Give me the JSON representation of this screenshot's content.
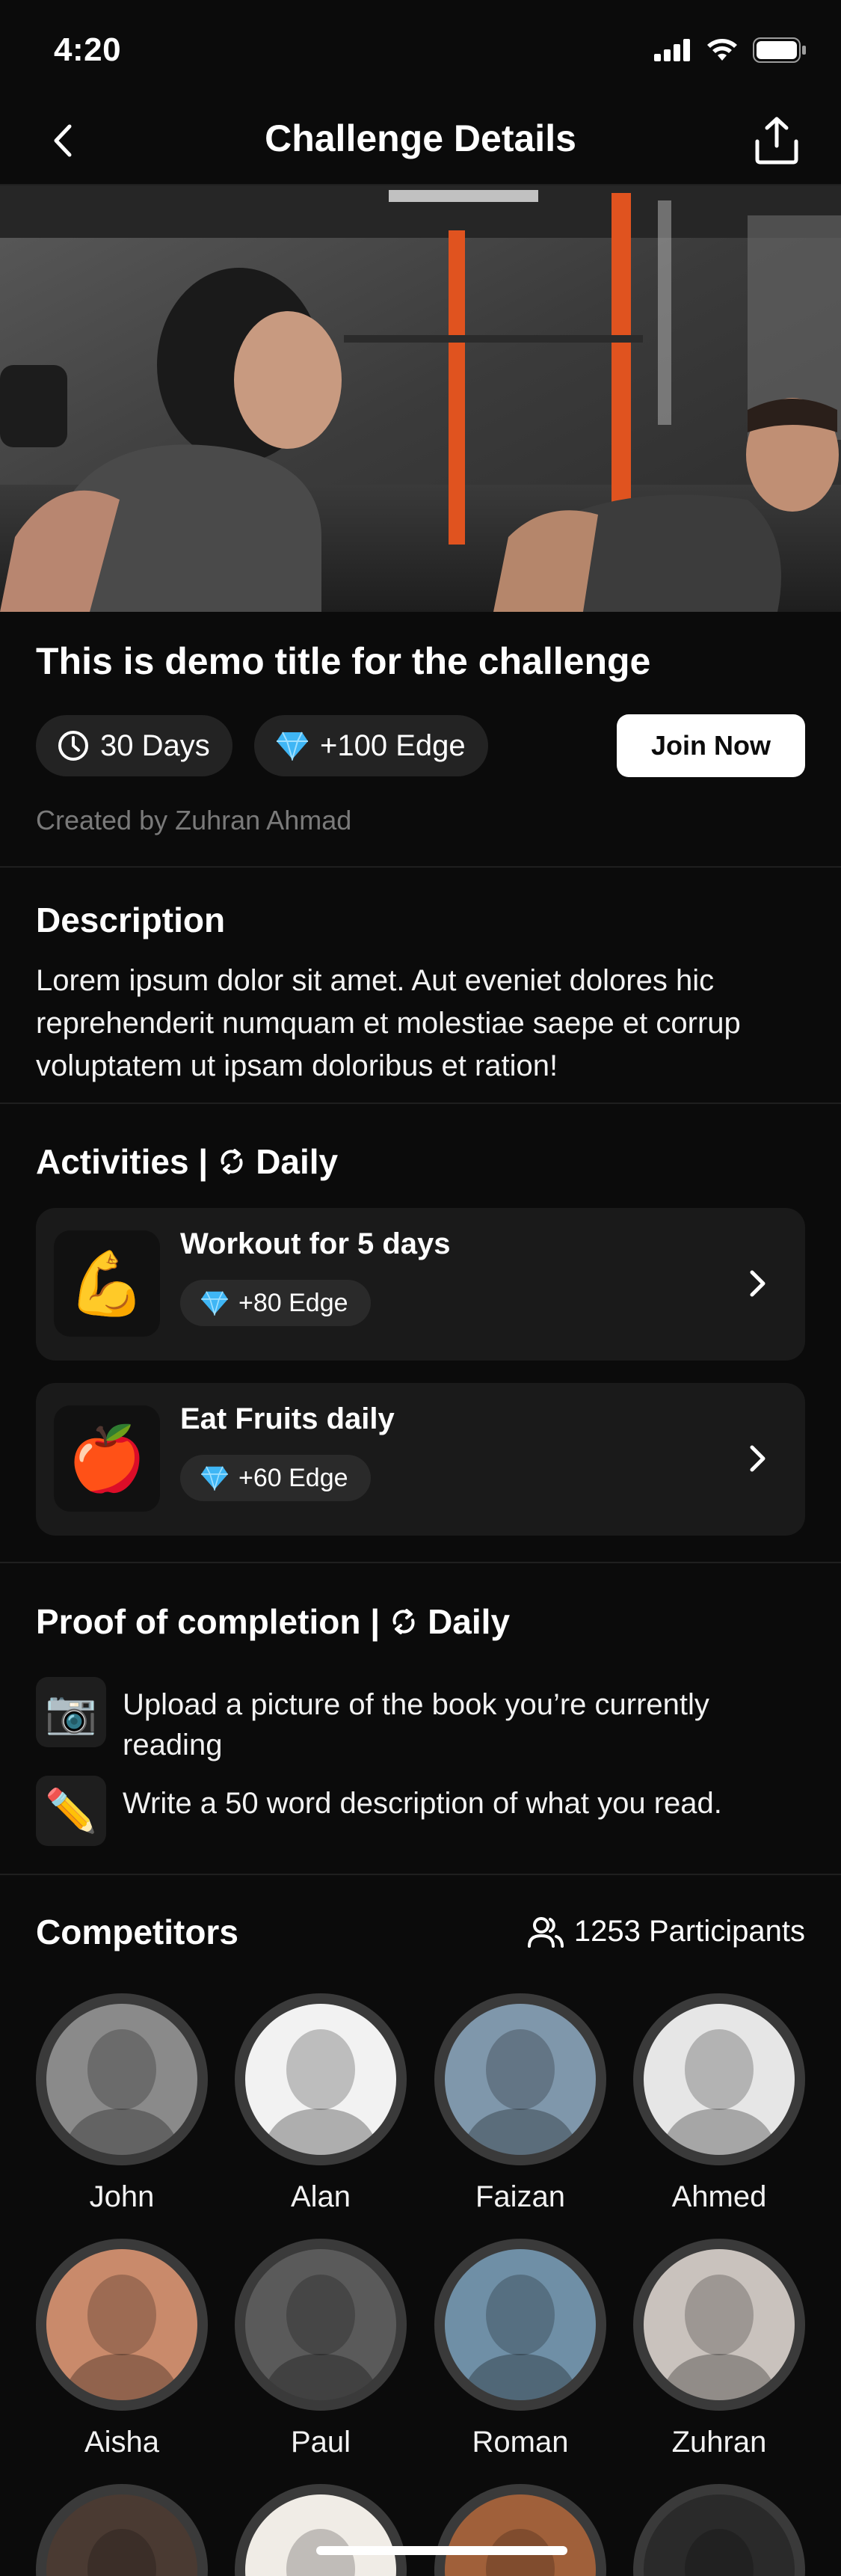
{
  "status_bar": {
    "time": "4:20"
  },
  "nav": {
    "title": "Challenge Details"
  },
  "challenge": {
    "title": "This is demo title for the challenge",
    "duration": "30 Days",
    "edge": "+100 Edge",
    "join_label": "Join Now",
    "created_by": "Created by Zuhran Ahmad"
  },
  "description": {
    "heading": "Description",
    "text": "Lorem ipsum dolor sit amet. Aut eveniet dolores hic reprehenderit numquam et molestiae saepe et corrup voluptatem ut ipsam doloribus et ration!"
  },
  "activities": {
    "heading": "Activities |",
    "frequency": "Daily",
    "items": [
      {
        "emoji": "💪",
        "name": "Workout for 5 days",
        "edge": "+80 Edge"
      },
      {
        "emoji": "🍎",
        "name": "Eat Fruits daily",
        "edge": "+60 Edge"
      }
    ]
  },
  "proof": {
    "heading": "Proof of completion |",
    "frequency": "Daily",
    "items": [
      {
        "emoji": "📷",
        "text": "Upload a picture of the book you’re currently reading"
      },
      {
        "emoji": "✏️",
        "text": "Write a 50 word description of what you read."
      }
    ]
  },
  "competitors": {
    "heading": "Competitors",
    "participants": "1253 Participants",
    "people": [
      {
        "name": "John",
        "color": "#8a8a8a"
      },
      {
        "name": "Alan",
        "color": "#f2f2f2"
      },
      {
        "name": "Faizan",
        "color": "#7f97ab"
      },
      {
        "name": "Ahmed",
        "color": "#e6e6e6"
      },
      {
        "name": "Aisha",
        "color": "#c98a6b"
      },
      {
        "name": "Paul",
        "color": "#5a5a5a"
      },
      {
        "name": "Roman",
        "color": "#6f8fa6"
      },
      {
        "name": "Zuhran",
        "color": "#c9c2bd"
      }
    ]
  },
  "colors": {
    "background": "#0b0b0b",
    "card": "#1a1a1a",
    "chip": "#232323",
    "diamond": "#3fb6f5"
  }
}
